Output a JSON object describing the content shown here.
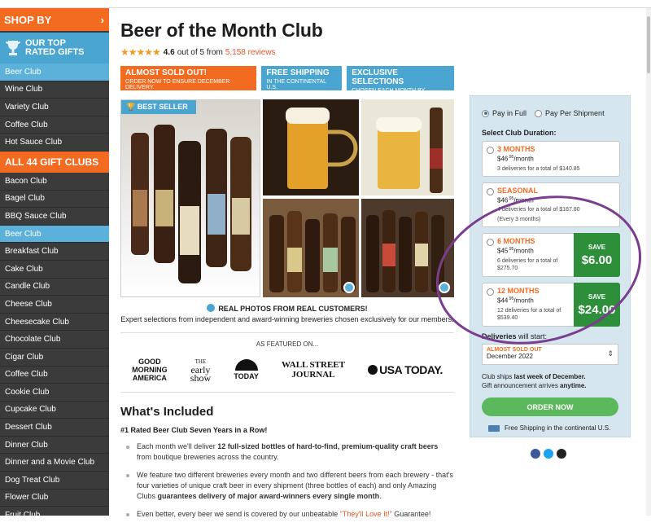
{
  "sidebar": {
    "shop_by": "SHOP BY",
    "shop_by_chevron": "›",
    "rated_line1": "OUR TOP",
    "rated_line2": "RATED GIFTS",
    "top_items": [
      "Beer Club",
      "Wine Club",
      "Variety Club",
      "Coffee Club",
      "Hot Sauce Club"
    ],
    "all_clubs": "ALL 44 GIFT CLUBS",
    "clubs": [
      "Bacon Club",
      "Bagel Club",
      "BBQ Sauce Club",
      "Beer Club",
      "Breakfast Club",
      "Cake Club",
      "Candle Club",
      "Cheese Club",
      "Cheesecake Club",
      "Chocolate Club",
      "Cigar Club",
      "Coffee Club",
      "Cookie Club",
      "Cupcake Club",
      "Dessert Club",
      "Dinner Club",
      "Dinner and a Movie Club",
      "Dog Treat Club",
      "Flower Club",
      "Fruit Club"
    ],
    "active_top": "Beer Club",
    "active_club": "Beer Club"
  },
  "product": {
    "title": "Beer of the Month Club",
    "stars": "★★★★★",
    "rating_value": "4.6",
    "rating_suffix": "out of 5 from",
    "reviews": "5,158 reviews"
  },
  "badges": {
    "almost_title": "ALMOST SOLD OUT!",
    "almost_sub": "ORDER NOW TO ENSURE DECEMBER DELIVERY.",
    "shipping_title": "FREE SHIPPING",
    "shipping_sub": "IN THE CONTINENTAL U.S.",
    "exclusive_title": "EXCLUSIVE SELECTIONS",
    "exclusive_sub": "CHOSEN EACH MONTH BY EXPERTS"
  },
  "gallery": {
    "best_seller": "BEST SELLER",
    "real_photos": "REAL PHOTOS FROM REAL CUSTOMERS!",
    "expert": "Expert selections from independent and award-winning breweries chosen exclusively for our members."
  },
  "featured": {
    "label": "AS FEATURED ON...",
    "gma_line1": "GOOD",
    "gma_line2": "MORNING",
    "gma_line3": "AMERICA",
    "early_line1": "THE",
    "early_line2": "early",
    "early_line3": "show",
    "today": "TODAY",
    "wsj_line1": "WALL STREET",
    "wsj_line2": "JOURNAL",
    "usa": "USA TODAY."
  },
  "included": {
    "heading": "What's Included",
    "rated": "#1 Rated Beer Club Seven Years in a Row!",
    "b1_pre": "Each month we'll deliver ",
    "b1_bold": "12 full-sized bottles of hard-to-find, premium-quality craft beers",
    "b1_post": " from boutique breweries across the country.",
    "b2_pre": "We feature two different breweries every month and two different beers from each brewery - that's four varieties of unique craft beer in every shipment (three bottles of each) and only Amazing Clubs ",
    "b2_bold": "guarantees delivery of major award-winners every single month",
    "b2_post": ".",
    "b3_pre": "Even better, every beer we send is covered by our unbeatable ",
    "b3_link": "\"They'll Love It!\"",
    "b3_post": " Guarantee!"
  },
  "panel": {
    "pay_full": "Pay in Full",
    "pay_ship": "Pay Per Shipment",
    "select_label": "Select Club Duration:",
    "options": [
      {
        "title": "3 MONTHS",
        "price": "$46",
        "cents": ".95",
        "per": "/month",
        "deliveries": "3 deliveries for a total of $140.85"
      },
      {
        "title": "SEASONAL",
        "price": "$46",
        "cents": ".95",
        "per": "/month",
        "deliveries": "4 deliveries for a total of $187.80",
        "note": "(Every 3 months)"
      },
      {
        "title": "6 MONTHS",
        "price": "$45",
        "cents": ".95",
        "per": "/month",
        "deliveries": "6 deliveries for a total of $275.70",
        "save_label": "SAVE",
        "save_value": "$6.00"
      },
      {
        "title": "12 MONTHS",
        "price": "$44",
        "cents": ".95",
        "per": "/month",
        "deliveries": "12 deliveries for a total of $539.40",
        "save_label": "SAVE",
        "save_value": "$24.00"
      }
    ],
    "deliveries_bold": "Deliveries",
    "deliveries_rest": " will start:",
    "select_top": "ALMOST SOLD OUT",
    "select_value": "December 2022",
    "ships_pre": "Club ships ",
    "ships_bold": "last week of December.",
    "gift_pre": "Gift announcement arrives ",
    "gift_bold": "anytime.",
    "order_now": "ORDER NOW",
    "free_shipping": "Free Shipping in the continental U.S."
  }
}
